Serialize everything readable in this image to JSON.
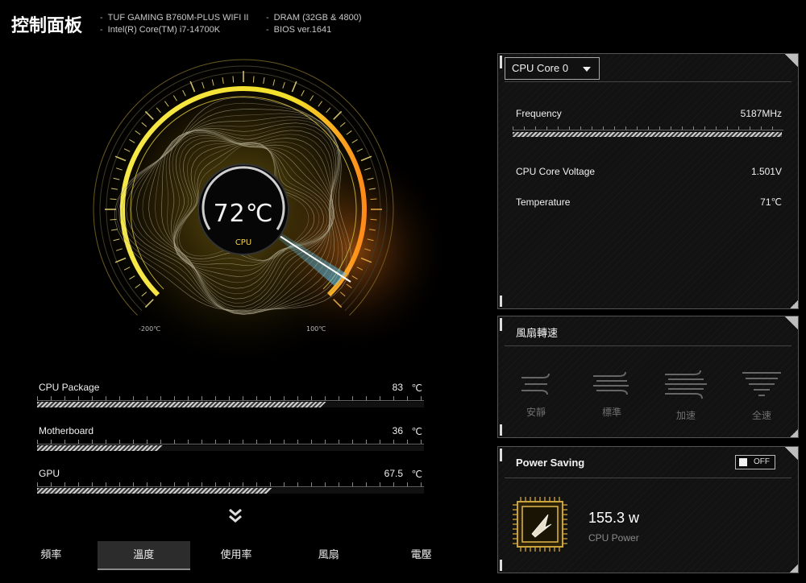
{
  "header": {
    "title": "控制面板",
    "sys_left": [
      "TUF GAMING B760M-PLUS WIFI II",
      "Intel(R) Core(TM) i7-14700K"
    ],
    "sys_right": [
      "DRAM (32GB & 4800)",
      "BIOS ver.1641"
    ]
  },
  "gauge": {
    "temperature": "72℃",
    "label": "CPU",
    "min_label": "-200℃",
    "max_label": "100℃",
    "fill_color": "#f3e02a",
    "hot_color": "#ff8a1a",
    "needle_color": "#5fd0ff"
  },
  "sensors": [
    {
      "name": "CPU Package",
      "value": "83",
      "unit": "℃",
      "fill_fraction": 0.83
    },
    {
      "name": "Motherboard",
      "value": "36",
      "unit": "℃",
      "fill_fraction": 0.36
    },
    {
      "name": "GPU",
      "value": "67.5",
      "unit": "℃",
      "fill_fraction": 0.675
    }
  ],
  "tabs": [
    "頻率",
    "溫度",
    "使用率",
    "風扇",
    "電壓"
  ],
  "active_tab": "溫度",
  "cpu_panel": {
    "selected_core": "CPU Core 0",
    "frequency_label": "Frequency",
    "frequency_value": "5187MHz",
    "voltage_label": "CPU Core Voltage",
    "voltage_value": "1.501V",
    "temp_label": "Temperature",
    "temp_value": "71℃"
  },
  "fan_panel": {
    "title": "風扇轉速",
    "modes": [
      {
        "label": "安靜",
        "icon": "fan-silent-icon"
      },
      {
        "label": "標準",
        "icon": "fan-standard-icon"
      },
      {
        "label": "加速",
        "icon": "fan-turbo-icon"
      },
      {
        "label": "全速",
        "icon": "fan-full-speed-icon"
      }
    ]
  },
  "power_panel": {
    "title": "Power Saving",
    "toggle_label": "OFF",
    "power_value": "155.3 w",
    "power_label": "CPU Power",
    "chip_icon": "power-chip-icon"
  }
}
